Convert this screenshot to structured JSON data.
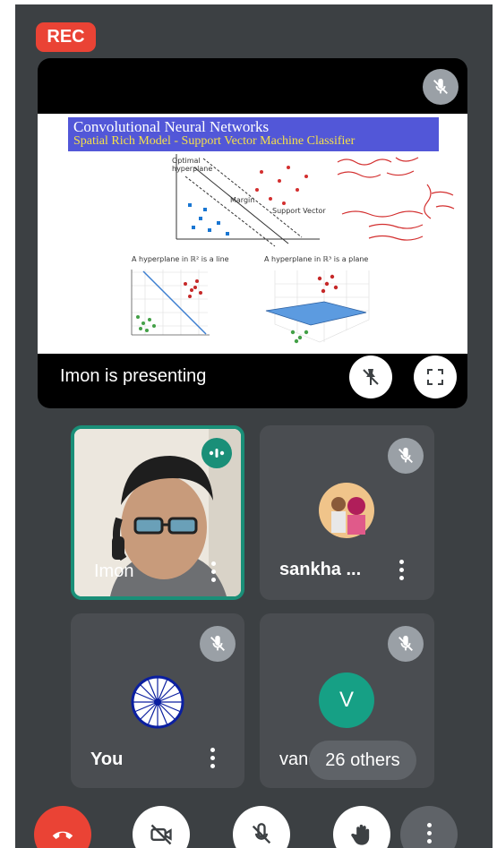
{
  "recording": {
    "label": "REC"
  },
  "presentation": {
    "presenter_label": "Imon is presenting",
    "slide": {
      "title": "Convolutional Neural Networks",
      "subtitle": "Spatial Rich Model - Support Vector Machine Classifier",
      "caption_left": "A hyperplane in ℝ² is a line",
      "caption_right": "A hyperplane in ℝ³ is a plane",
      "svm_labels": [
        "Optimal hyperplane",
        "Margin",
        "Support Vector"
      ]
    }
  },
  "participants": [
    {
      "name": "Imon",
      "speaking": true
    },
    {
      "name": "sankha ...",
      "muted": true
    },
    {
      "name": "You",
      "muted": true
    },
    {
      "name": "vand",
      "initial": "V",
      "muted": true
    }
  ],
  "others_chip": "26 others",
  "colors": {
    "background": "#3c4043",
    "tile": "#4a4d51",
    "rec": "#ea4335",
    "speaking": "#1a8f78",
    "end_call": "#ea4335"
  },
  "icons": [
    "mic-off-icon",
    "pin-off-icon",
    "fullscreen-icon",
    "more-vert-icon",
    "speaking-icon",
    "end-call-icon",
    "camera-off-icon",
    "raise-hand-icon"
  ]
}
